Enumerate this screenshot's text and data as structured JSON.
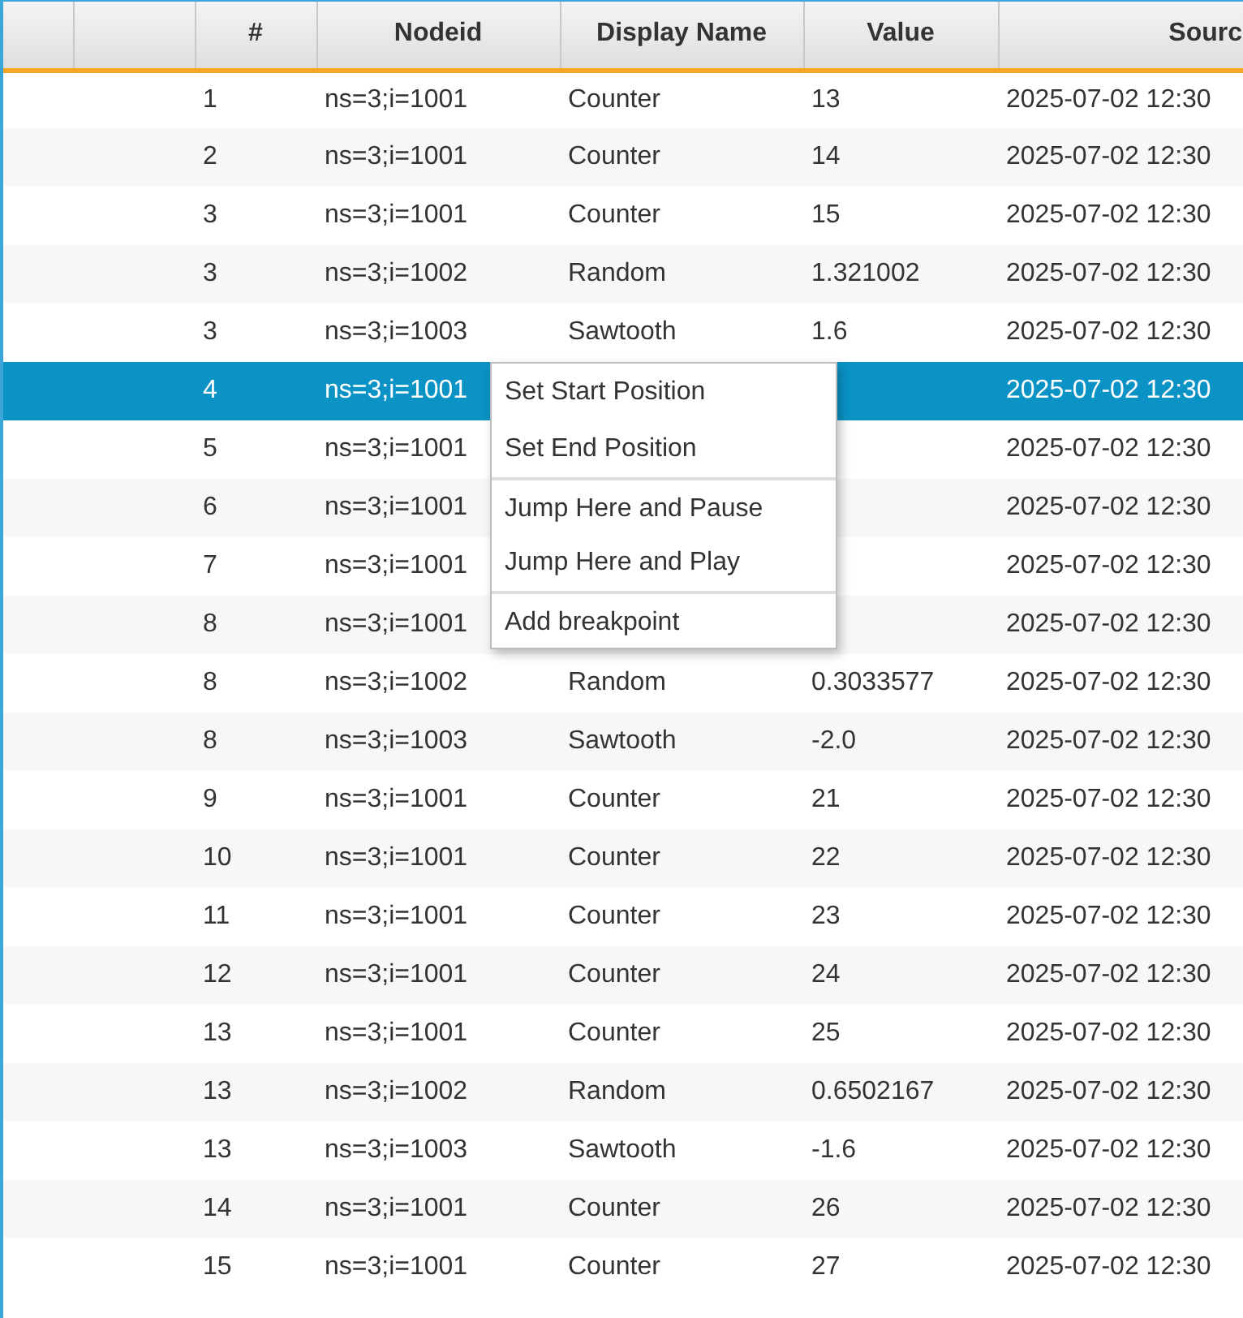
{
  "table": {
    "columns": [
      "#",
      "Nodeid",
      "Display Name",
      "Value",
      "Sourc"
    ],
    "rows": [
      {
        "number": "1",
        "nodeid": "ns=3;i=1001",
        "display_name": "Counter",
        "value": "13",
        "source": "2025-07-02 12:30",
        "selected": false
      },
      {
        "number": "2",
        "nodeid": "ns=3;i=1001",
        "display_name": "Counter",
        "value": "14",
        "source": "2025-07-02 12:30",
        "selected": false
      },
      {
        "number": "3",
        "nodeid": "ns=3;i=1001",
        "display_name": "Counter",
        "value": "15",
        "source": "2025-07-02 12:30",
        "selected": false
      },
      {
        "number": "3",
        "nodeid": "ns=3;i=1002",
        "display_name": "Random",
        "value": "1.321002",
        "source": "2025-07-02 12:30",
        "selected": false
      },
      {
        "number": "3",
        "nodeid": "ns=3;i=1003",
        "display_name": "Sawtooth",
        "value": "1.6",
        "source": "2025-07-02 12:30",
        "selected": false
      },
      {
        "number": "4",
        "nodeid": "ns=3;i=1001",
        "source": "2025-07-02 12:30",
        "selected": true
      },
      {
        "number": "5",
        "nodeid": "ns=3;i=1001",
        "source": "2025-07-02 12:30",
        "selected": false
      },
      {
        "number": "6",
        "nodeid": "ns=3;i=1001",
        "source": "2025-07-02 12:30",
        "selected": false
      },
      {
        "number": "7",
        "nodeid": "ns=3;i=1001",
        "source": "2025-07-02 12:30",
        "selected": false
      },
      {
        "number": "8",
        "nodeid": "ns=3;i=1001",
        "source": "2025-07-02 12:30",
        "selected": false
      },
      {
        "number": "8",
        "nodeid": "ns=3;i=1002",
        "display_name": "Random",
        "value": "0.3033577",
        "source": "2025-07-02 12:30",
        "selected": false
      },
      {
        "number": "8",
        "nodeid": "ns=3;i=1003",
        "display_name": "Sawtooth",
        "value": "-2.0",
        "source": "2025-07-02 12:30",
        "selected": false
      },
      {
        "number": "9",
        "nodeid": "ns=3;i=1001",
        "display_name": "Counter",
        "value": "21",
        "source": "2025-07-02 12:30",
        "selected": false
      },
      {
        "number": "10",
        "nodeid": "ns=3;i=1001",
        "display_name": "Counter",
        "value": "22",
        "source": "2025-07-02 12:30",
        "selected": false
      },
      {
        "number": "11",
        "nodeid": "ns=3;i=1001",
        "display_name": "Counter",
        "value": "23",
        "source": "2025-07-02 12:30",
        "selected": false
      },
      {
        "number": "12",
        "nodeid": "ns=3;i=1001",
        "display_name": "Counter",
        "value": "24",
        "source": "2025-07-02 12:30",
        "selected": false
      },
      {
        "number": "13",
        "nodeid": "ns=3;i=1001",
        "display_name": "Counter",
        "value": "25",
        "source": "2025-07-02 12:30",
        "selected": false
      },
      {
        "number": "13",
        "nodeid": "ns=3;i=1002",
        "display_name": "Random",
        "value": "0.6502167",
        "source": "2025-07-02 12:30",
        "selected": false
      },
      {
        "number": "13",
        "nodeid": "ns=3;i=1003",
        "display_name": "Sawtooth",
        "value": "-1.6",
        "source": "2025-07-02 12:30",
        "selected": false
      },
      {
        "number": "14",
        "nodeid": "ns=3;i=1001",
        "display_name": "Counter",
        "value": "26",
        "source": "2025-07-02 12:30",
        "selected": false
      },
      {
        "number": "15",
        "nodeid": "ns=3;i=1001",
        "display_name": "Counter",
        "value": "27",
        "source": "2025-07-02 12:30",
        "selected": false
      }
    ]
  },
  "context_menu": {
    "items": [
      {
        "label": "Set Start Position",
        "separator_before": false
      },
      {
        "label": "Set End Position",
        "separator_before": false
      },
      {
        "label": "Jump Here and Pause",
        "separator_before": true
      },
      {
        "label": "Jump Here and Play",
        "separator_before": false
      },
      {
        "label": "Add breakpoint",
        "separator_before": true
      }
    ]
  }
}
